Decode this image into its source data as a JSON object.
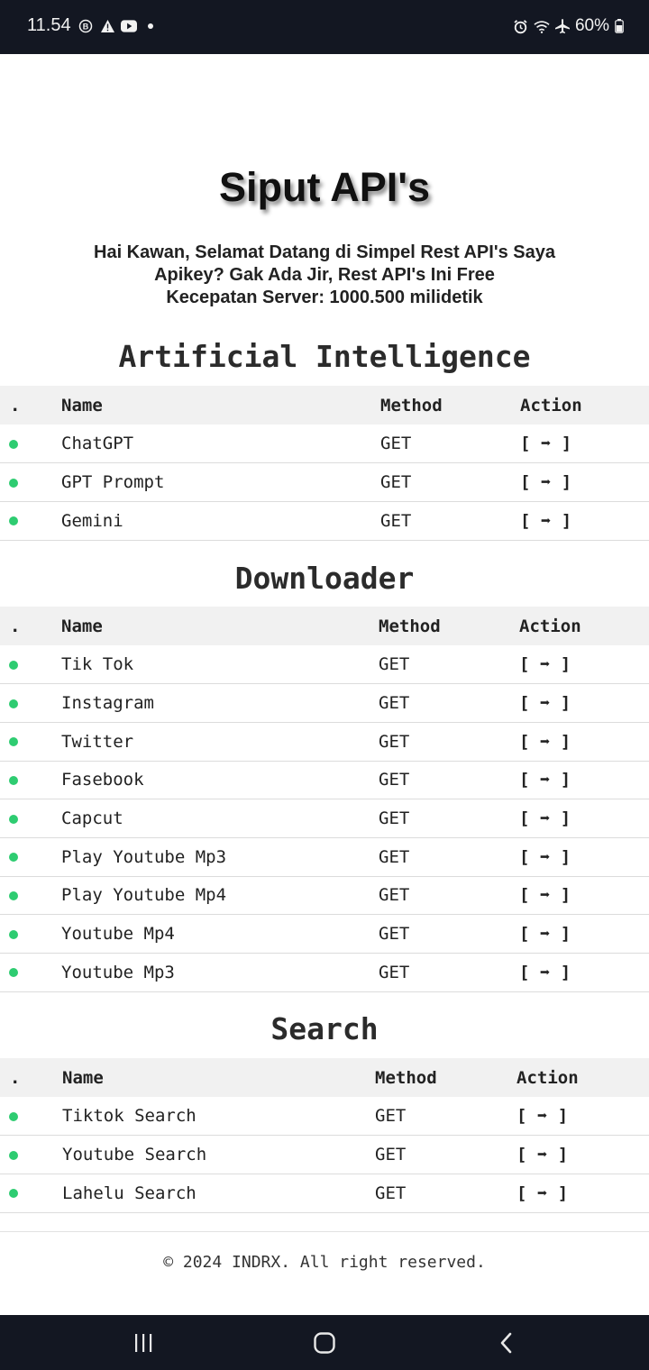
{
  "status_bar": {
    "time": "11.54",
    "battery": "60%",
    "left_icons": [
      "b-circle-icon",
      "warning-icon",
      "youtube-icon",
      "dot-icon"
    ],
    "right_icons": [
      "alarm-icon",
      "wifi-icon",
      "airplane-icon",
      "battery-icon"
    ]
  },
  "page": {
    "title": "Siput API's",
    "intro_line1": "Hai Kawan, Selamat Datang di Simpel Rest API's Saya",
    "intro_line2": "Apikey? Gak Ada Jir, Rest API's Ini Free",
    "intro_line3": "Kecepatan Server: 1000.500 milidetik"
  },
  "columns": {
    "dot": ".",
    "name": "Name",
    "method": "Method",
    "action": "Action"
  },
  "sections": [
    {
      "title": "Artificial Intelligence",
      "rows": [
        {
          "name": "ChatGPT",
          "method": "GET",
          "action": "[ ➡ ]"
        },
        {
          "name": "GPT Prompt",
          "method": "GET",
          "action": "[ ➡ ]"
        },
        {
          "name": "Gemini",
          "method": "GET",
          "action": "[ ➡ ]"
        }
      ]
    },
    {
      "title": "Downloader",
      "rows": [
        {
          "name": "Tik Tok",
          "method": "GET",
          "action": "[ ➡ ]"
        },
        {
          "name": "Instagram",
          "method": "GET",
          "action": "[ ➡ ]"
        },
        {
          "name": "Twitter",
          "method": "GET",
          "action": "[ ➡ ]"
        },
        {
          "name": "Fasebook",
          "method": "GET",
          "action": "[ ➡ ]"
        },
        {
          "name": "Capcut",
          "method": "GET",
          "action": "[ ➡ ]"
        },
        {
          "name": "Play Youtube Mp3",
          "method": "GET",
          "action": "[ ➡ ]"
        },
        {
          "name": "Play Youtube Mp4",
          "method": "GET",
          "action": "[ ➡ ]"
        },
        {
          "name": "Youtube Mp4",
          "method": "GET",
          "action": "[ ➡ ]"
        },
        {
          "name": "Youtube Mp3",
          "method": "GET",
          "action": "[ ➡ ]"
        }
      ]
    },
    {
      "title": "Search",
      "rows": [
        {
          "name": "Tiktok Search",
          "method": "GET",
          "action": "[ ➡ ]"
        },
        {
          "name": "Youtube Search",
          "method": "GET",
          "action": "[ ➡ ]"
        },
        {
          "name": "Lahelu Search",
          "method": "GET",
          "action": "[ ➡ ]"
        }
      ]
    }
  ],
  "footer": {
    "text": "© 2024 INDRX. All right reserved."
  },
  "colors": {
    "status_dot": "#2ecc71",
    "system_bar": "#131722",
    "header_row": "#f1f1f1"
  },
  "nav_bar": {
    "buttons": [
      "recent-apps-icon",
      "home-icon",
      "back-icon"
    ]
  }
}
